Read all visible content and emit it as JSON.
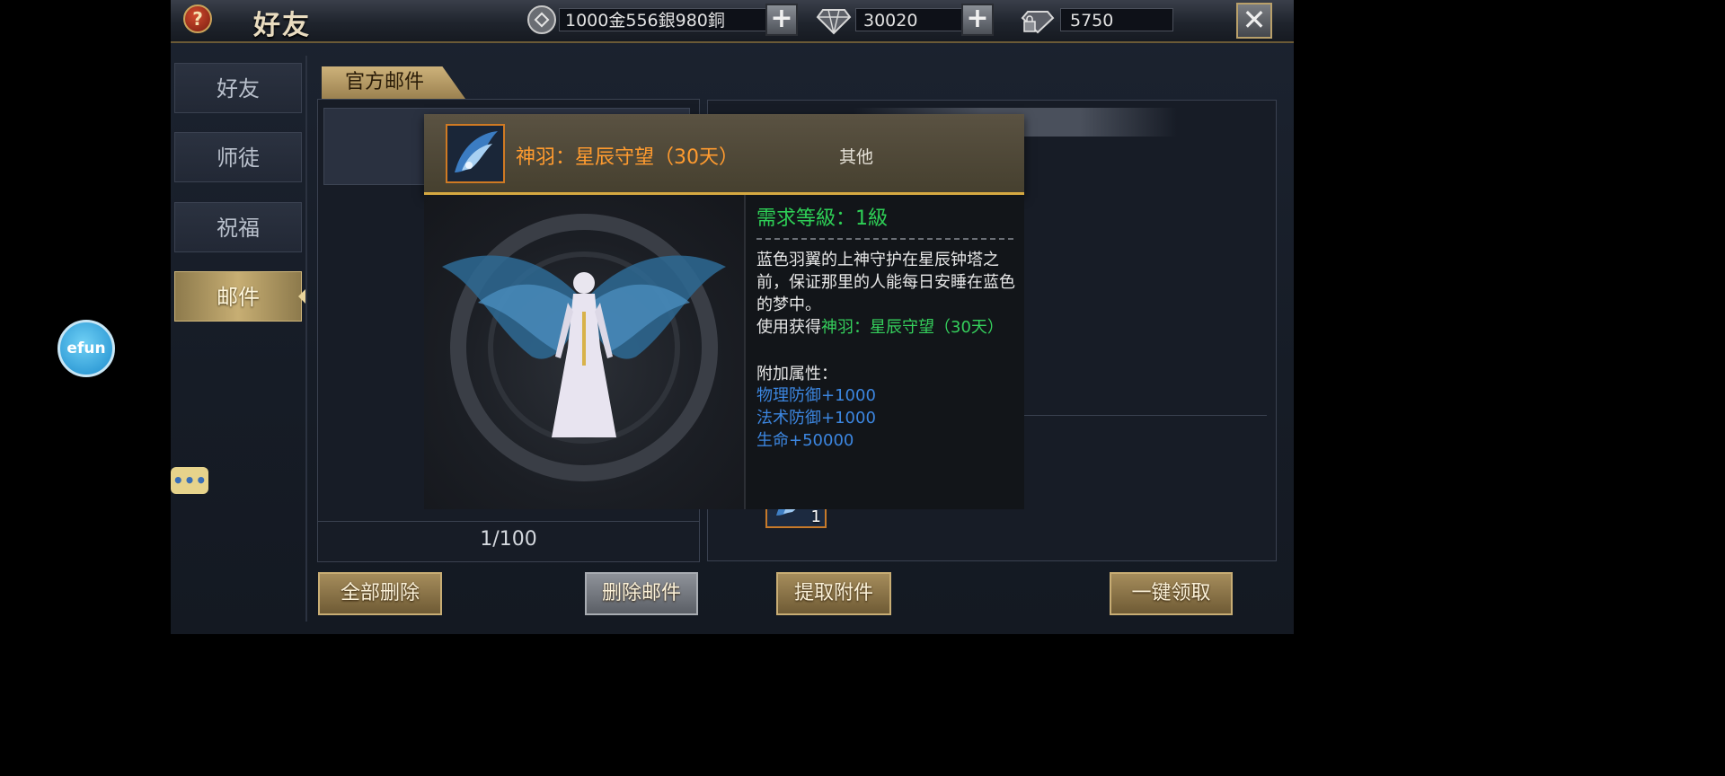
{
  "topbar": {
    "help_icon": "question-mark-icon",
    "title": "好友",
    "money": "1000金556銀980銅",
    "diamonds": "30020",
    "bound_diamonds": "5750",
    "coin_icon": "coin-icon",
    "diamond_icon": "diamond-icon",
    "bound_diamond_icon": "locked-diamond-icon",
    "plus_label": "+",
    "close_label": "✕"
  },
  "sidebar": {
    "items": [
      {
        "label": "好友"
      },
      {
        "label": "师徒"
      },
      {
        "label": "祝福"
      },
      {
        "label": "邮件",
        "active": true
      }
    ]
  },
  "mail": {
    "tab_label": "官方邮件",
    "pager": "1/100",
    "attachment_count": "1"
  },
  "tooltip": {
    "item_name": "神羽：星辰守望（30天）",
    "item_type": "其他",
    "required_level": "需求等級：1級",
    "description": "蓝色羽翼的上神守护在星辰钟塔之前，保证那里的人能每日安睡在蓝色的梦中。",
    "use_prefix": "使用获得",
    "use_item": "神羽：星辰守望（30天）",
    "attr_title": "附加属性：",
    "attrs": [
      "物理防御+1000",
      "法术防御+1000",
      "生命+50000"
    ]
  },
  "buttons": {
    "delete_all": "全部删除",
    "delete_mail": "删除邮件",
    "extract": "提取附件",
    "claim_all": "一键领取"
  },
  "floating": {
    "efun_label": "efun",
    "chat_label": "•••"
  },
  "colors": {
    "accent_gold": "#c8ad74",
    "item_orange": "#ff9b2f",
    "level_green": "#2ecf56",
    "attr_blue": "#3c86e0"
  }
}
